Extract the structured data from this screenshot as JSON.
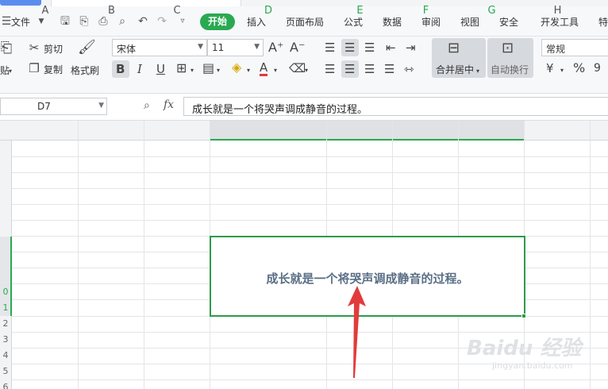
{
  "menu": {
    "file": "文件",
    "items": [
      "开始",
      "插入",
      "页面布局",
      "公式",
      "数据",
      "审阅",
      "视图",
      "安全",
      "开发工具",
      "特"
    ]
  },
  "ribbon": {
    "paste_fragment": "贴",
    "cut": "剪切",
    "copy": "复制",
    "format_painter": "格式刷",
    "font_name": "宋体",
    "font_size": "11",
    "grow_font": "A⁺",
    "shrink_font": "A⁻",
    "bold": "B",
    "italic": "I",
    "underline": "U",
    "merge_center": "合并居中",
    "wrap_text": "自动换行",
    "number_format": "常规",
    "percent": "%",
    "comma": "9"
  },
  "formula_bar": {
    "cell_ref": "D7",
    "fx": "fx",
    "content": "成长就是一个将哭声调成静音的过程。"
  },
  "columns": [
    "A",
    "B",
    "C",
    "D",
    "E",
    "F",
    "G",
    "H"
  ],
  "rows": [
    "",
    "",
    "",
    "",
    "",
    "",
    "",
    "",
    "0",
    "1",
    "2",
    "3",
    "4",
    "5",
    "6"
  ],
  "merged_cell": {
    "text": "成长就是一个将哭声调成静音的过程。"
  },
  "watermark": {
    "brand": "Baidu 经验",
    "url": "jingyan.baidu.com"
  },
  "colors": {
    "accent": "#2aa952",
    "selection_border": "#2d9b4a",
    "arrow": "#e23b3b",
    "cell_text": "#5a6f86"
  }
}
